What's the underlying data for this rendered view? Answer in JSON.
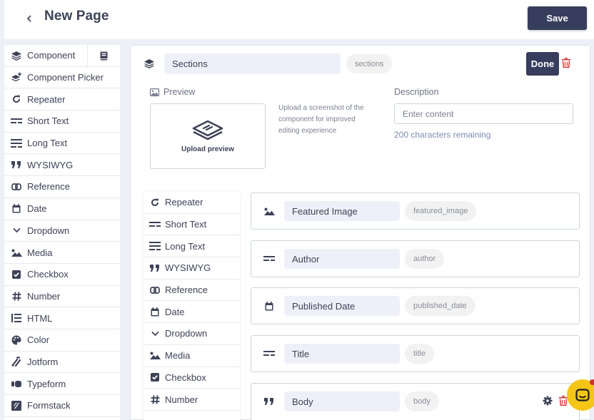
{
  "header": {
    "back_icon": "chevron-left-icon",
    "title": "New Page",
    "save_label": "Save"
  },
  "sidebar": {
    "items": [
      {
        "label": "Component",
        "icon": "layers-icon"
      },
      {
        "label": "Component Picker",
        "icon": "layers-plus-icon"
      },
      {
        "label": "Repeater",
        "icon": "redo-icon"
      },
      {
        "label": "Short Text",
        "icon": "short-text-icon"
      },
      {
        "label": "Long Text",
        "icon": "long-text-icon"
      },
      {
        "label": "WYSIWYG",
        "icon": "quote-icon"
      },
      {
        "label": "Reference",
        "icon": "link-icon"
      },
      {
        "label": "Date",
        "icon": "calendar-icon"
      },
      {
        "label": "Dropdown",
        "icon": "chevron-down-icon"
      },
      {
        "label": "Media",
        "icon": "image-icon"
      },
      {
        "label": "Checkbox",
        "icon": "checkbox-icon"
      },
      {
        "label": "Number",
        "icon": "hash-icon"
      },
      {
        "label": "HTML",
        "icon": "html-icon"
      },
      {
        "label": "Color",
        "icon": "palette-icon"
      },
      {
        "label": "Jotform",
        "icon": "jotform-icon"
      },
      {
        "label": "Typeform",
        "icon": "typeform-icon"
      },
      {
        "label": "Formstack",
        "icon": "formstack-icon"
      }
    ],
    "book_icon": "book-icon"
  },
  "section": {
    "name": "Sections",
    "slug": "sections",
    "done_label": "Done",
    "preview_label": "Preview",
    "upload_label": "Upload preview",
    "upload_help": "Upload a screenshot of the component for improved editing experience",
    "description_label": "Description",
    "description_placeholder": "Enter content",
    "description_value": "",
    "chars_remaining": "200 characters remaining"
  },
  "inner_list": {
    "items": [
      {
        "label": "Repeater",
        "icon": "redo-icon"
      },
      {
        "label": "Short Text",
        "icon": "short-text-icon"
      },
      {
        "label": "Long Text",
        "icon": "long-text-icon"
      },
      {
        "label": "WYSIWYG",
        "icon": "quote-icon"
      },
      {
        "label": "Reference",
        "icon": "link-icon"
      },
      {
        "label": "Date",
        "icon": "calendar-icon"
      },
      {
        "label": "Dropdown",
        "icon": "chevron-down-icon"
      },
      {
        "label": "Media",
        "icon": "image-icon"
      },
      {
        "label": "Checkbox",
        "icon": "checkbox-icon"
      },
      {
        "label": "Number",
        "icon": "hash-icon"
      }
    ]
  },
  "fields": [
    {
      "name": "Featured Image",
      "slug": "featured_image",
      "icon": "image-icon"
    },
    {
      "name": "Author",
      "slug": "author",
      "icon": "short-text-icon"
    },
    {
      "name": "Published Date",
      "slug": "published_date",
      "icon": "calendar-icon"
    },
    {
      "name": "Title",
      "slug": "title",
      "icon": "short-text-icon"
    },
    {
      "name": "Body",
      "slug": "body",
      "icon": "quote-icon"
    }
  ],
  "colors": {
    "primary_button": "#373d5c",
    "danger": "#d32f2f",
    "chat_bubble": "#f5c518",
    "accent_text": "#7e8db0"
  }
}
